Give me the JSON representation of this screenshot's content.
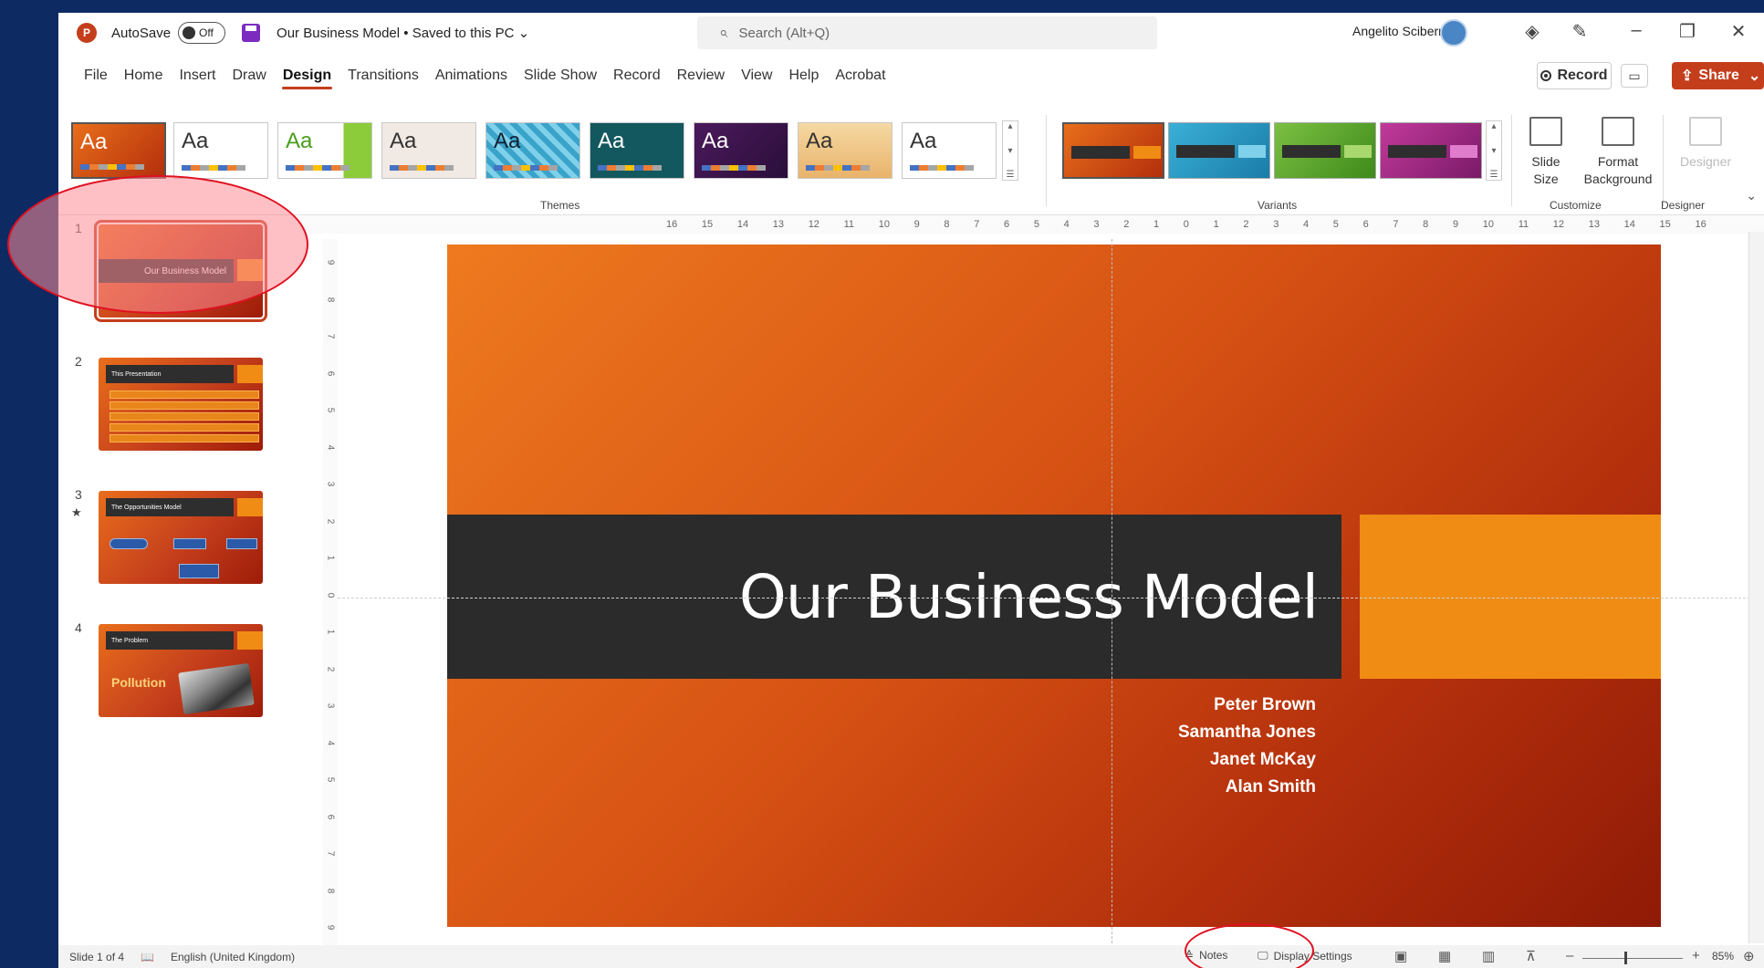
{
  "titlebar": {
    "autosave_label": "AutoSave",
    "autosave_state": "Off",
    "doc_title": "Our Business Model • Saved to this PC",
    "doc_title_chevron": "chevron-down-icon",
    "search_placeholder": "Search (Alt+Q)",
    "user_name": "Angelito Sciberras"
  },
  "menu": {
    "tabs": [
      "File",
      "Home",
      "Insert",
      "Draw",
      "Design",
      "Transitions",
      "Animations",
      "Slide Show",
      "Record",
      "Review",
      "View",
      "Help",
      "Acrobat"
    ],
    "active_tab": "Design",
    "record_label": "Record",
    "share_label": "Share"
  },
  "ribbon": {
    "themes_label": "Themes",
    "variants_label": "Variants",
    "customize_label": "Customize",
    "designer_group_label": "Designer",
    "theme_sample": "Aa",
    "slide_size_label": "Slide Size",
    "format_background_label": "Format Background",
    "designer_button_label": "Designer"
  },
  "slides": [
    {
      "number": "1",
      "title": "Our Business Model"
    },
    {
      "number": "2",
      "title": "This Presentation"
    },
    {
      "number": "3",
      "title": "The Opportunities Model"
    },
    {
      "number": "4",
      "title": "The Problem",
      "body": "Pollution"
    }
  ],
  "main_slide": {
    "title": "Our Business Model",
    "presenters": [
      "Peter Brown",
      "Samantha Jones",
      "Janet McKay",
      "Alan Smith"
    ]
  },
  "rulers": {
    "horizontal": [
      "16",
      "15",
      "14",
      "13",
      "12",
      "11",
      "10",
      "9",
      "8",
      "7",
      "6",
      "5",
      "4",
      "3",
      "2",
      "1",
      "0",
      "1",
      "2",
      "3",
      "4",
      "5",
      "6",
      "7",
      "8",
      "9",
      "10",
      "11",
      "12",
      "13",
      "14",
      "15",
      "16"
    ],
    "vertical": [
      "9",
      "8",
      "7",
      "6",
      "5",
      "4",
      "3",
      "2",
      "1",
      "0",
      "1",
      "2",
      "3",
      "4",
      "5",
      "6",
      "7",
      "8",
      "9"
    ]
  },
  "statusbar": {
    "slide_counter": "Slide 1 of 4",
    "language": "English (United Kingdom)",
    "notes_label": "Notes",
    "display_settings_label": "Display Settings",
    "zoom_level": "85%"
  },
  "colors": {
    "accent": "#c43e1c",
    "slide_orange": "#f08c14",
    "title_band": "#2b2b2b",
    "annotation_red": "#e01020"
  }
}
